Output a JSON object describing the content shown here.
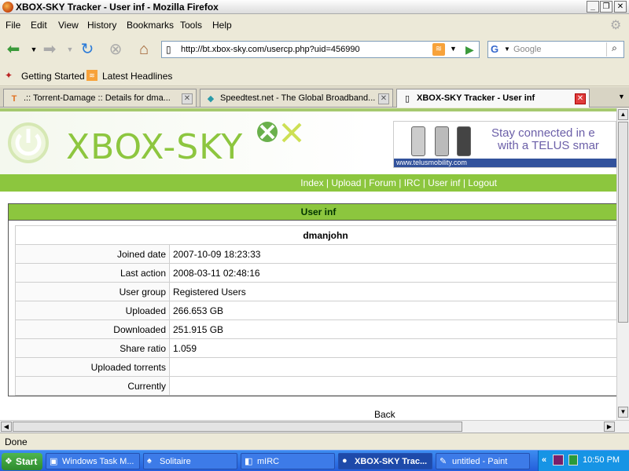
{
  "window": {
    "title": "XBOX-SKY Tracker - User inf - Mozilla Firefox"
  },
  "menu": [
    "File",
    "Edit",
    "View",
    "History",
    "Bookmarks",
    "Tools",
    "Help"
  ],
  "address": {
    "url": "http://bt.xbox-sky.com/usercp.php?uid=456990"
  },
  "search": {
    "placeholder": "Google"
  },
  "bookmarks": [
    "Getting Started",
    "Latest Headlines"
  ],
  "tabs": [
    {
      "label": ".:: Torrent-Damage :: Details for dma..."
    },
    {
      "label": "Speedtest.net - The Global Broadband..."
    },
    {
      "label": "XBOX-SKY Tracker - User inf"
    }
  ],
  "page": {
    "logo": "XBOX-SKY",
    "ad": {
      "line1": "Stay connected in e",
      "line2": "with a TELUS smar",
      "link": "www.telusmobility.com"
    },
    "nav": [
      "Index",
      "Upload",
      "Forum",
      "IRC",
      "User inf",
      "Logout"
    ],
    "panel_title": "User inf",
    "username": "dmanjohn",
    "rows": [
      {
        "label": "Joined date",
        "value": "2007-10-09 18:23:33"
      },
      {
        "label": "Last action",
        "value": "2008-03-11 02:48:16"
      },
      {
        "label": "User group",
        "value": "Registered Users"
      },
      {
        "label": "Uploaded",
        "value": "266.653 GB"
      },
      {
        "label": "Downloaded",
        "value": "251.915 GB"
      },
      {
        "label": "Share ratio",
        "value": "1.059"
      },
      {
        "label": "Uploaded torrents",
        "value": ""
      },
      {
        "label": "Currently",
        "value": ""
      }
    ],
    "back": "Back"
  },
  "status": "Done",
  "taskbar": {
    "start": "Start",
    "items": [
      "Windows Task M...",
      "Solitaire",
      "mIRC",
      "XBOX-SKY Trac...",
      "untitled - Paint"
    ],
    "clock": "10:50 PM"
  }
}
